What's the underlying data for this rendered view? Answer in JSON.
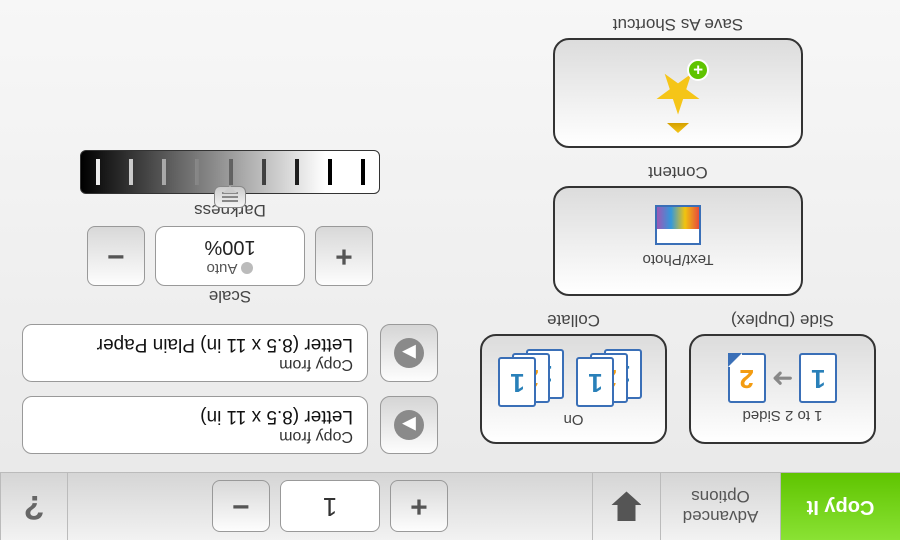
{
  "topbar": {
    "copy_it": "Copy It",
    "advanced_l1": "Advanced",
    "advanced_l2": "Options",
    "count": "1",
    "plus": "+",
    "minus": "−",
    "help": "?"
  },
  "duplex": {
    "label": "Side (Duplex)",
    "caption": "1 to 2 Sided"
  },
  "collate": {
    "label": "Collate",
    "caption": "On"
  },
  "content": {
    "label": "Content",
    "caption": "Text/Photo"
  },
  "shortcut": {
    "label": "Save As Shortcut"
  },
  "copy_from": {
    "label": "Copy from",
    "value": "Letter (8.5 x 11 in)"
  },
  "copy_from2": {
    "label": "Copy from",
    "value": "Letter (8.5 x 11 in) Plain Paper"
  },
  "scale": {
    "label": "Scale",
    "auto_lbl": "Auto",
    "pct": "100%",
    "plus": "+",
    "minus": "−"
  },
  "darkness": {
    "label": "Darkness"
  }
}
